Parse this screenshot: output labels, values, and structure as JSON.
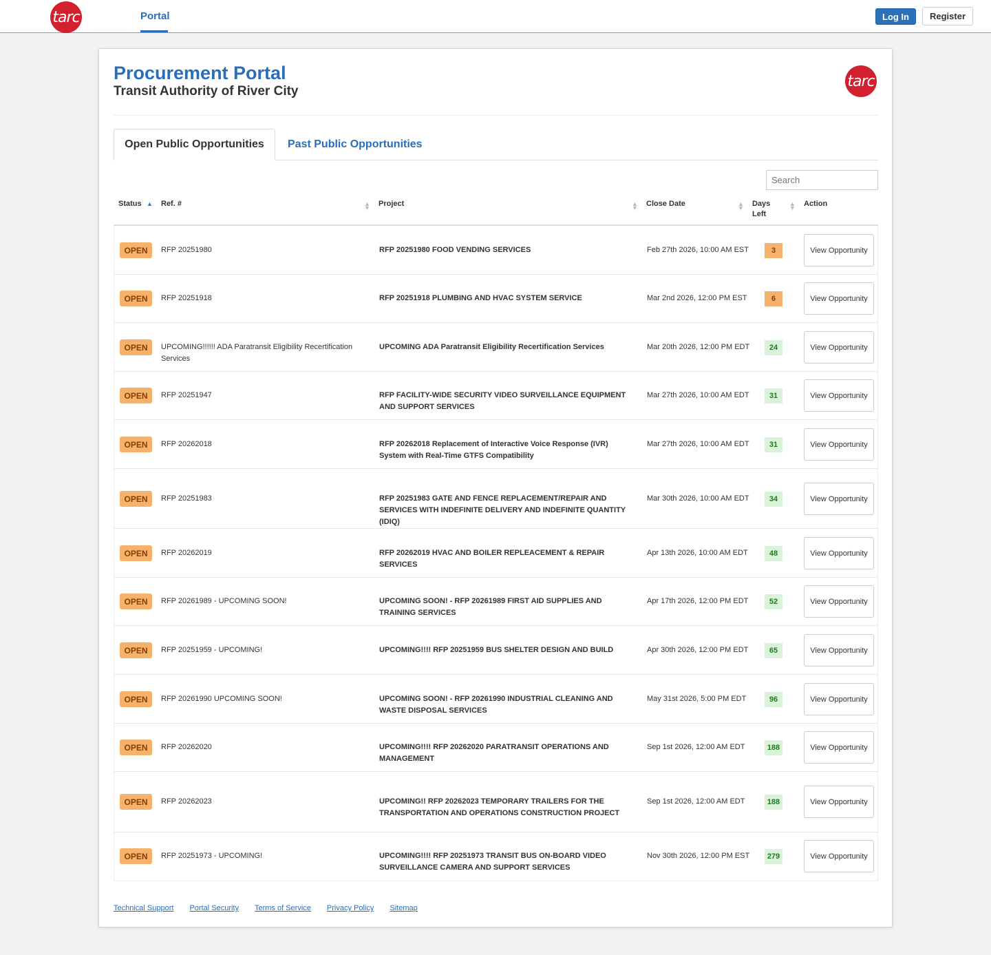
{
  "header": {
    "logo_text": "tarc",
    "nav_portal": "Portal",
    "login_label": "Log In",
    "register_label": "Register"
  },
  "page": {
    "title": "Procurement Portal",
    "subtitle": "Transit Authority of River City",
    "logo_text": "tarc"
  },
  "tabs": {
    "open": "Open Public Opportunities",
    "past": "Past Public Opportunities"
  },
  "search": {
    "placeholder": "Search"
  },
  "table": {
    "headers": {
      "status": "Status",
      "ref": "Ref. #",
      "project": "Project",
      "close_date": "Close Date",
      "days_left": "Days Left",
      "action": "Action"
    },
    "rows": [
      {
        "status": "OPEN",
        "ref": "RFP 20251980",
        "project": "RFP 20251980 FOOD VENDING SERVICES",
        "close_date": "Feb 27th 2026, 10:00 AM EST",
        "days_left": "3",
        "days_color": "#f6b26b",
        "action": "View Opportunity"
      },
      {
        "status": "OPEN",
        "ref": "RFP 20251918",
        "project": "RFP 20251918 PLUMBING AND HVAC SYSTEM SERVICE",
        "close_date": "Mar 2nd 2026, 12:00 PM EST",
        "days_left": "6",
        "days_color": "#f6b26b",
        "action": "View Opportunity"
      },
      {
        "status": "OPEN",
        "ref": "UPCOMING!!!!!! ADA Paratransit Eligibility Recertification Services",
        "project": "UPCOMING ADA Paratransit Eligibility Recertification Services",
        "close_date": "Mar 20th 2026, 12:00 PM EDT",
        "days_left": "24",
        "days_color": "#d9f2d9",
        "action": "View Opportunity"
      },
      {
        "status": "OPEN",
        "ref": "RFP 20251947",
        "project": "RFP FACILITY-WIDE SECURITY VIDEO SURVEILLANCE EQUIPMENT AND SUPPORT SERVICES",
        "close_date": "Mar 27th 2026, 10:00 AM EDT",
        "days_left": "31",
        "days_color": "#d9f2d9",
        "action": "View Opportunity"
      },
      {
        "status": "OPEN",
        "ref": "RFP 20262018",
        "project": "RFP 20262018 Replacement of Interactive Voice Response (IVR) System with Real-Time GTFS Compatibility",
        "close_date": "Mar 27th 2026, 10:00 AM EDT",
        "days_left": "31",
        "days_color": "#d9f2d9",
        "action": "View Opportunity"
      },
      {
        "status": "OPEN",
        "ref": "RFP 20251983",
        "project": "RFP 20251983 GATE AND FENCE REPLACEMENT/REPAIR AND SERVICES WITH INDEFINITE DELIVERY AND INDEFINITE QUANTITY (IDIQ)",
        "close_date": "Mar 30th 2026, 10:00 AM EDT",
        "days_left": "34",
        "days_color": "#d9f2d9",
        "action": "View Opportunity"
      },
      {
        "status": "OPEN",
        "ref": "RFP 20262019",
        "project": "RFP 20262019 HVAC AND BOILER REPLEACEMENT & REPAIR SERVICES",
        "close_date": "Apr 13th 2026, 10:00 AM EDT",
        "days_left": "48",
        "days_color": "#d9f2d9",
        "action": "View Opportunity"
      },
      {
        "status": "OPEN",
        "ref": "RFP 20261989 - UPCOMING SOON!",
        "project": "UPCOMING SOON! - RFP 20261989 FIRST AID SUPPLIES AND TRAINING SERVICES",
        "close_date": "Apr 17th 2026, 12:00 PM EDT",
        "days_left": "52",
        "days_color": "#d9f2d9",
        "action": "View Opportunity"
      },
      {
        "status": "OPEN",
        "ref": "RFP 20251959 - UPCOMING!",
        "project": "UPCOMING!!!! RFP 20251959 BUS SHELTER DESIGN AND BUILD",
        "close_date": "Apr 30th 2026, 12:00 PM EDT",
        "days_left": "65",
        "days_color": "#d9f2d9",
        "action": "View Opportunity"
      },
      {
        "status": "OPEN",
        "ref": "RFP 20261990 UPCOMING SOON!",
        "project": "UPCOMING SOON! - RFP 20261990 INDUSTRIAL CLEANING AND WASTE DISPOSAL SERVICES",
        "close_date": "May 31st 2026, 5:00 PM EDT",
        "days_left": "96",
        "days_color": "#d9f2d9",
        "action": "View Opportunity"
      },
      {
        "status": "OPEN",
        "ref": "RFP 20262020",
        "project": "UPCOMING!!!! RFP 20262020 PARATRANSIT OPERATIONS AND MANAGEMENT",
        "close_date": "Sep 1st 2026, 12:00 AM EDT",
        "days_left": "188",
        "days_color": "#d9f2d9",
        "action": "View Opportunity"
      },
      {
        "status": "OPEN",
        "ref": "RFP 20262023",
        "project": "UPCOMING!! RFP 20262023 TEMPORARY TRAILERS FOR THE TRANSPORTATION AND OPERATIONS CONSTRUCTION PROJECT",
        "close_date": "Sep 1st 2026, 12:00 AM EDT",
        "days_left": "188",
        "days_color": "#d9f2d9",
        "action": "View Opportunity"
      },
      {
        "status": "OPEN",
        "ref": "RFP 20251973 - UPCOMING!",
        "project": "UPCOMING!!!! RFP 20251973 TRANSIT BUS ON-BOARD VIDEO SURVEILLANCE CAMERA AND SUPPORT SERVICES",
        "close_date": "Nov 30th 2026, 12:00 PM EST",
        "days_left": "279",
        "days_color": "#d9f2d9",
        "action": "View Opportunity"
      }
    ]
  },
  "footer": {
    "links": [
      "Technical Support",
      "Portal Security",
      "Terms of Service",
      "Privacy Policy",
      "Sitemap"
    ]
  },
  "colors": {
    "brand_blue": "#2a6ebb",
    "brand_red": "#d3202e",
    "badge_orange": "#f6b26b",
    "days_green": "#d9f2d9"
  }
}
